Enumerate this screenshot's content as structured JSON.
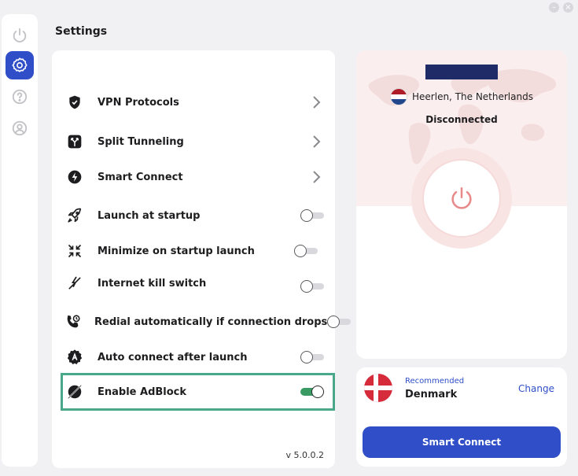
{
  "window": {
    "minimize_glyph": "–",
    "close_glyph": "×"
  },
  "nav": {
    "items": [
      {
        "icon": "power-icon",
        "active": false
      },
      {
        "icon": "gear-icon",
        "active": true
      },
      {
        "icon": "help-icon",
        "active": false
      },
      {
        "icon": "account-icon",
        "active": false
      }
    ]
  },
  "page": {
    "title": "Settings"
  },
  "settings": {
    "vpn_protocols": {
      "label": "VPN Protocols",
      "icon": "shield-icon"
    },
    "split_tunneling": {
      "label": "Split Tunneling",
      "icon": "split-icon"
    },
    "smart_connect": {
      "label": "Smart Connect",
      "icon": "lightning-icon"
    },
    "launch_startup": {
      "label": "Launch at startup",
      "icon": "rocket-icon",
      "enabled": false
    },
    "minimize_startup": {
      "label": "Minimize on startup launch",
      "icon": "minimize-arrows-icon",
      "enabled": false
    },
    "kill_switch": {
      "label": "Internet kill switch",
      "icon": "kill-switch-icon",
      "enabled": false
    },
    "redial": {
      "label": "Redial automatically if connection drops",
      "icon": "phone-redial-icon",
      "enabled": false
    },
    "auto_connect": {
      "label": "Auto connect after launch",
      "icon": "auto-badge-icon",
      "enabled": false
    },
    "adblock": {
      "label": "Enable AdBlock",
      "icon": "adblock-icon",
      "enabled": true
    },
    "version": "v 5.0.0.2"
  },
  "connection": {
    "location": "Heerlen, The Netherlands",
    "status": "Disconnected",
    "power_icon": "power-icon"
  },
  "server": {
    "recommended_label": "Recommended",
    "country": "Denmark",
    "change_label": "Change",
    "connect_label": "Smart Connect"
  },
  "colors": {
    "accent": "#2f4ec8",
    "toggle_on": "#3a9a64",
    "highlight": "#4aa88a",
    "disconnected_power": "#e98a8a"
  }
}
